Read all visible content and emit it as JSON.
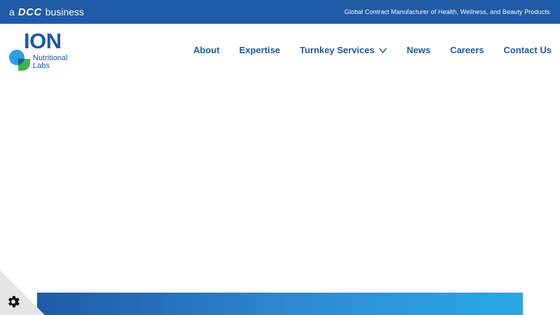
{
  "topbar": {
    "brand_prefix": "a",
    "brand_name": "DCC",
    "brand_suffix": "business",
    "tagline": "Global Contract Manufacturer of Health, Wellness, and Beauty Products."
  },
  "logo": {
    "name": "ION",
    "subtitle_line1": "Nutritional",
    "subtitle_line2": "Labs"
  },
  "nav": {
    "items": [
      {
        "label": "About"
      },
      {
        "label": "Expertise"
      },
      {
        "label": "Turnkey Services",
        "has_dropdown": true,
        "icon": "chevron-down-icon"
      },
      {
        "label": "News"
      },
      {
        "label": "Careers"
      },
      {
        "label": "Contact Us"
      }
    ]
  },
  "cookie_settings": {
    "icon": "gear-icon"
  },
  "colors": {
    "brand_blue": "#1f5aa6",
    "accent_cyan": "#27a8e6",
    "logo_green": "#3ab54a",
    "logo_light_blue": "#2b9fe0"
  }
}
